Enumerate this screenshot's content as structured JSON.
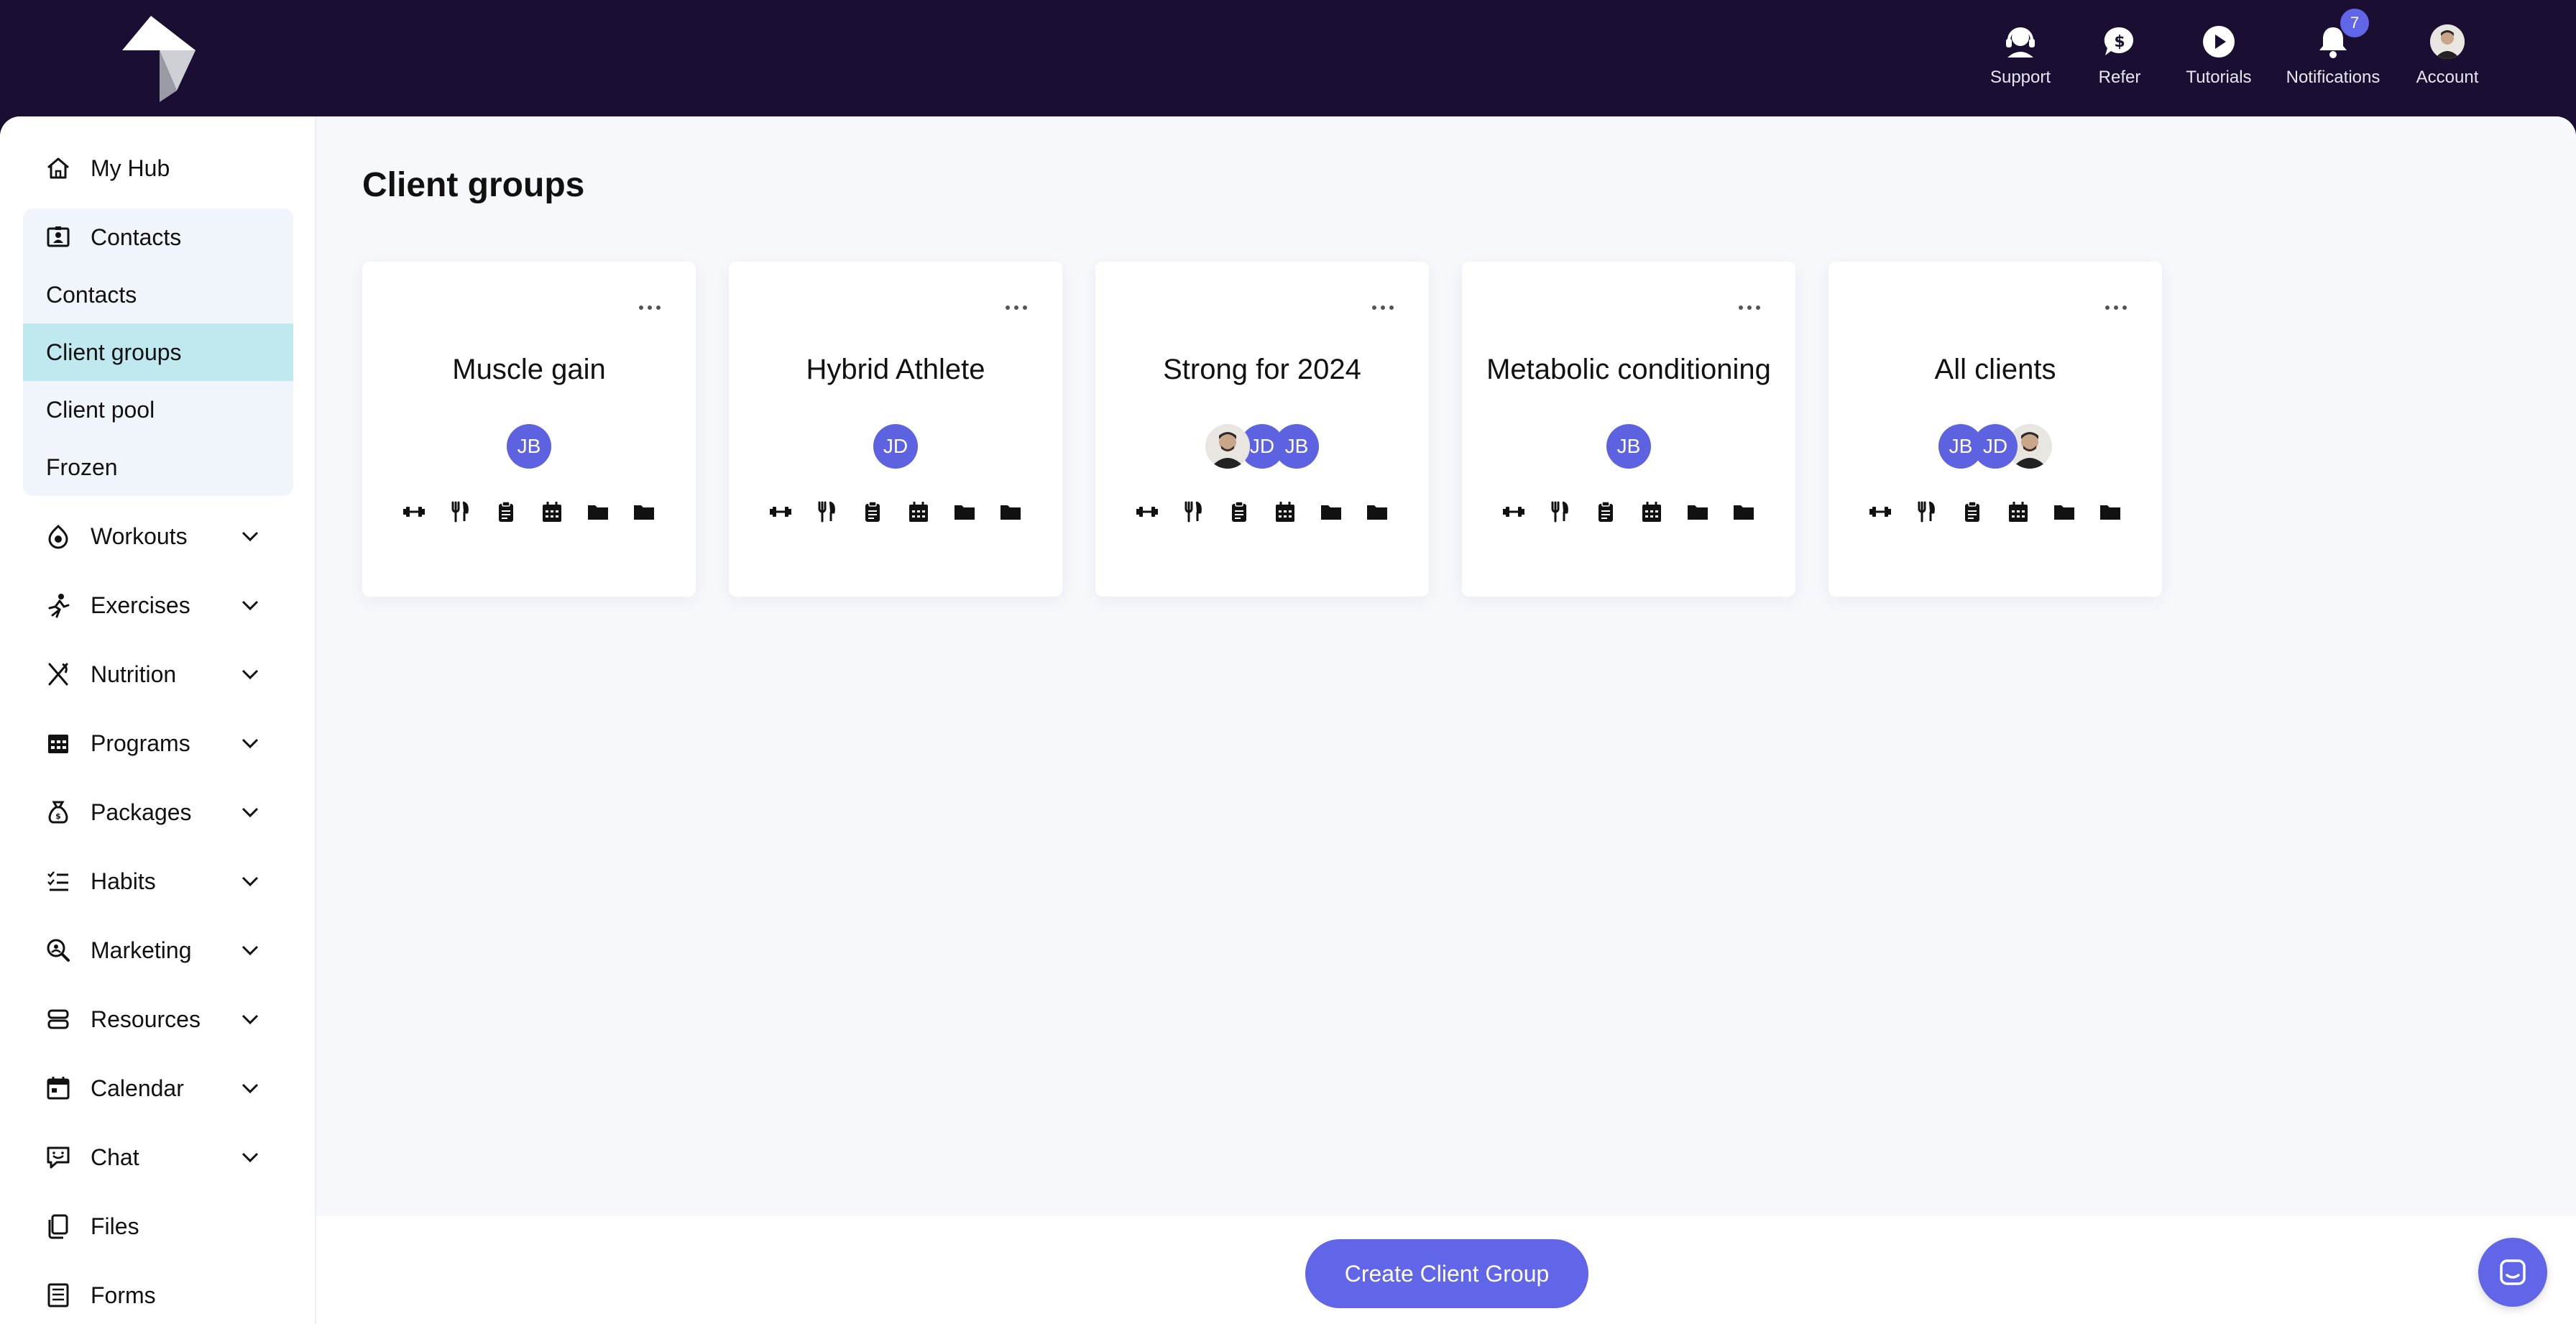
{
  "header": {
    "logo": "app-logo",
    "nav": [
      {
        "label": "Support",
        "icon": "headset-icon"
      },
      {
        "label": "Refer",
        "icon": "dollar-bubble-icon"
      },
      {
        "label": "Tutorials",
        "icon": "play-icon"
      },
      {
        "label": "Notifications",
        "icon": "bell-icon",
        "badge": "7"
      },
      {
        "label": "Account",
        "icon": "avatar"
      }
    ]
  },
  "sidebar": {
    "my_hub": "My Hub",
    "contacts_header": "Contacts",
    "contacts_sub": [
      "Contacts",
      "Client groups",
      "Client pool",
      "Frozen"
    ],
    "active_sub": "Client groups",
    "items": [
      {
        "label": "Workouts",
        "icon": "workout-icon"
      },
      {
        "label": "Exercises",
        "icon": "running-icon"
      },
      {
        "label": "Nutrition",
        "icon": "utensils-icon"
      },
      {
        "label": "Programs",
        "icon": "calendar-grid-icon"
      },
      {
        "label": "Packages",
        "icon": "money-bag-icon"
      },
      {
        "label": "Habits",
        "icon": "checklist-icon"
      },
      {
        "label": "Marketing",
        "icon": "magnify-icon"
      },
      {
        "label": "Resources",
        "icon": "stack-icon"
      },
      {
        "label": "Calendar",
        "icon": "calendar-icon"
      },
      {
        "label": "Chat",
        "icon": "chat-icon"
      },
      {
        "label": "Files",
        "icon": "files-icon"
      },
      {
        "label": "Forms",
        "icon": "form-icon"
      }
    ]
  },
  "main": {
    "title": "Client groups",
    "groups": [
      {
        "name": "Muscle gain",
        "avatars": [
          "JB"
        ]
      },
      {
        "name": "Hybrid Athlete",
        "avatars": [
          "JD"
        ]
      },
      {
        "name": "Strong for 2024",
        "avatars": [
          "photo",
          "JD",
          "JB"
        ]
      },
      {
        "name": "Metabolic conditioning",
        "avatars": [
          "JB"
        ]
      },
      {
        "name": "All clients",
        "avatars": [
          "JB",
          "JD",
          "photo"
        ]
      }
    ],
    "card_icons": [
      "dumbbell-icon",
      "fork-knife-icon",
      "clipboard-icon",
      "calendar-icon",
      "folder-icon",
      "folder-icon"
    ]
  },
  "footer": {
    "create_label": "Create Client Group"
  },
  "colors": {
    "header_bg": "#1a0f33",
    "accent": "#6166e8",
    "active_bg": "#bfe9ef",
    "group_bg": "#f0f5fb",
    "main_bg": "#f7f8fc"
  }
}
